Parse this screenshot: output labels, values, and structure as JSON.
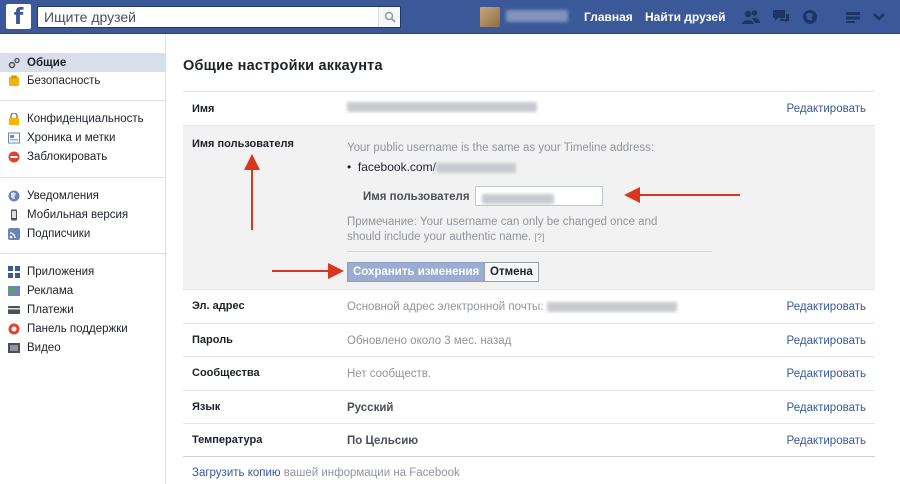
{
  "topbar": {
    "logo": "f",
    "search_placeholder": "Ищите друзей",
    "nav_home": "Главная",
    "nav_find_friends": "Найти друзей",
    "icons": [
      "friend-requests-icon",
      "messages-icon",
      "notifications-icon",
      "privacy-shortcuts-icon",
      "account-menu-icon"
    ]
  },
  "sidebar": {
    "groups": [
      [
        {
          "label": "Общие",
          "icon": "gear-icon",
          "active": true
        },
        {
          "label": "Безопасность",
          "icon": "shield-icon",
          "active": false
        }
      ],
      [
        {
          "label": "Конфиденциальность",
          "icon": "lock-icon",
          "active": false
        },
        {
          "label": "Хроника и метки",
          "icon": "timeline-icon",
          "active": false
        },
        {
          "label": "Заблокировать",
          "icon": "block-icon",
          "active": false
        }
      ],
      [
        {
          "label": "Уведомления",
          "icon": "globe-icon",
          "active": false
        },
        {
          "label": "Мобильная версия",
          "icon": "mobile-icon",
          "active": false
        },
        {
          "label": "Подписчики",
          "icon": "rss-icon",
          "active": false
        }
      ],
      [
        {
          "label": "Приложения",
          "icon": "apps-icon",
          "active": false
        },
        {
          "label": "Реклама",
          "icon": "ads-icon",
          "active": false
        },
        {
          "label": "Платежи",
          "icon": "payments-icon",
          "active": false
        },
        {
          "label": "Панель поддержки",
          "icon": "support-icon",
          "active": false
        },
        {
          "label": "Видео",
          "icon": "video-icon",
          "active": false
        }
      ]
    ]
  },
  "main": {
    "title": "Общие настройки аккаунта",
    "edit_label": "Редактировать",
    "name_row": {
      "label": "Имя"
    },
    "username_section": {
      "label": "Имя пользователя",
      "info": "Your public username is the same as your Timeline address:",
      "url_prefix": "facebook.com/",
      "field_label": "Имя пользователя",
      "note": "Примечание: Your username can only be changed once and should include your authentic name.",
      "help": "[?]",
      "save_button": "Сохранить изменения",
      "cancel_button": "Отмена"
    },
    "email_row": {
      "label": "Эл. адрес",
      "value": "Основной адрес электронной почты:"
    },
    "password_row": {
      "label": "Пароль",
      "value": "Обновлено около 3 мес. назад"
    },
    "communities_row": {
      "label": "Сообщества",
      "value": "Нет сообществ."
    },
    "language_row": {
      "label": "Язык",
      "value": "Русский"
    },
    "temperature_row": {
      "label": "Температура",
      "value": "По Цельсию"
    },
    "footer": {
      "link": "Загрузить копию",
      "text": " вашей информации на Facebook"
    }
  },
  "colors": {
    "brand": "#3b5998",
    "link": "#365899",
    "arrow": "#d9361b"
  }
}
